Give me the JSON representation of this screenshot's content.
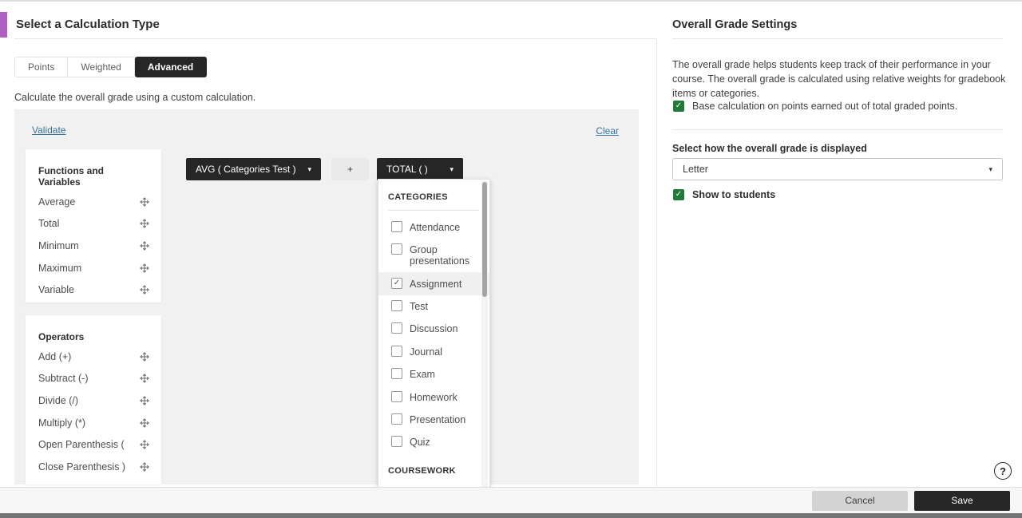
{
  "colors": {
    "accent_purple": "#b060c2",
    "chip_black": "#262626",
    "checkbox_green": "#217a37",
    "link_blue": "#34749e"
  },
  "left": {
    "title": "Select a Calculation Type",
    "tabs": [
      {
        "label": "Points",
        "active": false
      },
      {
        "label": "Weighted",
        "active": false
      },
      {
        "label": "Advanced",
        "active": true
      }
    ],
    "description": "Calculate the overall grade using a custom calculation.",
    "canvas": {
      "validate_link": "Validate",
      "clear_link": "Clear",
      "functions_panel": {
        "title": "Functions and Variables",
        "items": [
          "Average",
          "Total",
          "Minimum",
          "Maximum",
          "Variable"
        ]
      },
      "operators_panel": {
        "title": "Operators",
        "items": [
          "Add (+)",
          "Subtract (-)",
          "Divide (/)",
          "Multiply (*)",
          "Open Parenthesis (",
          "Close Parenthesis )"
        ]
      },
      "expression": {
        "avg_chip": "AVG ( Categories Test )",
        "plus_chip": "+",
        "total_chip": "TOTAL ( )",
        "caret": "▾"
      },
      "dropdown": {
        "sections": [
          {
            "header": "CATEGORIES",
            "items": [
              {
                "label": "Attendance",
                "checked": false
              },
              {
                "label": "Group presentations",
                "checked": false
              },
              {
                "label": "Assignment",
                "checked": true
              },
              {
                "label": "Test",
                "checked": false
              },
              {
                "label": "Discussion",
                "checked": false
              },
              {
                "label": "Journal",
                "checked": false
              },
              {
                "label": "Exam",
                "checked": false
              },
              {
                "label": "Homework",
                "checked": false
              },
              {
                "label": "Presentation",
                "checked": false
              },
              {
                "label": "Quiz",
                "checked": false
              }
            ]
          },
          {
            "header": "COURSEWORK"
          }
        ]
      }
    }
  },
  "right": {
    "title": "Overall Grade Settings",
    "description": "The overall grade helps students keep track of their performance in your course. The overall grade is calculated using relative weights for gradebook items or categories.",
    "base_points": {
      "label": "Base calculation on points earned out of total graded points.",
      "checked": true
    },
    "display_label": "Select how the overall grade is displayed",
    "display_select": {
      "value": "Letter"
    },
    "show_students": {
      "label": "Show to students",
      "checked": true
    }
  },
  "footer": {
    "cancel_label": "Cancel",
    "save_label": "Save"
  },
  "help": {
    "glyph": "?"
  }
}
